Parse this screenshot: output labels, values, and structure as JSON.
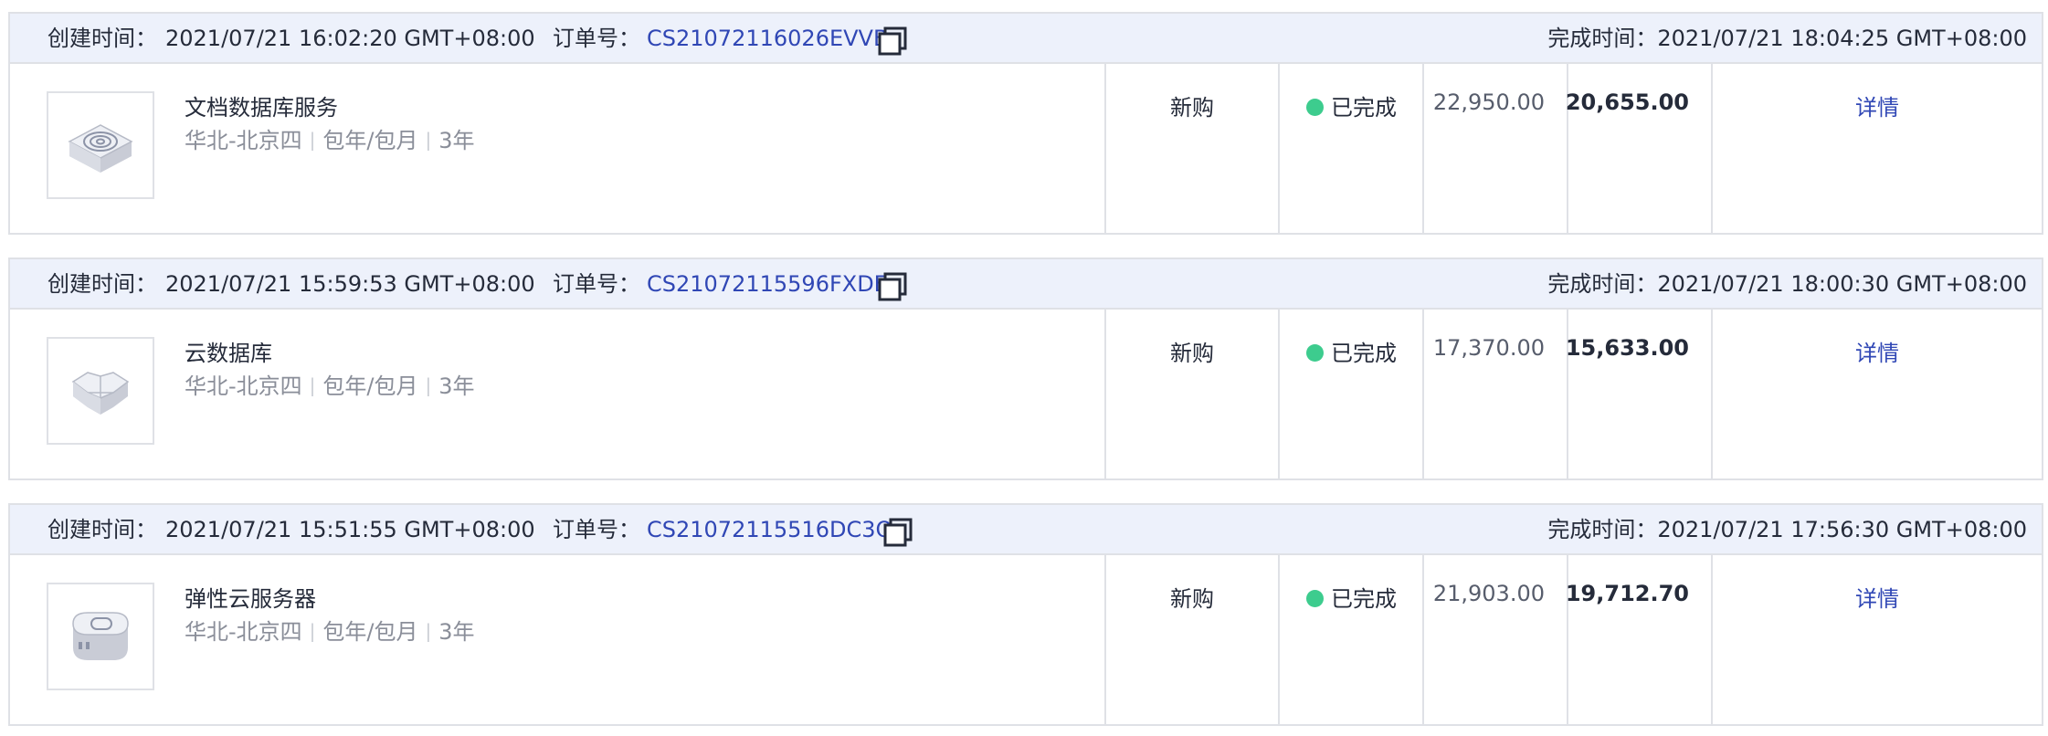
{
  "labels": {
    "created": "创建时间：",
    "order_no": "订单号：",
    "completed": "完成时间：",
    "separator": "|"
  },
  "colors": {
    "link": "#3047b5",
    "status_done": "#3dcc8e",
    "header_bg": "#edf1fb",
    "border": "#dfe1e6"
  },
  "orders": [
    {
      "created_time": "2021/07/21 16:02:20 GMT+08:00",
      "order_id": "CS21072116026EVVB",
      "completed_time": "2021/07/21 18:04:25 GMT+08:00",
      "product_icon": "document-database-icon",
      "product_name": "文档数据库服务",
      "region": "华北-北京四",
      "billing": "包年/包月",
      "duration": "3年",
      "order_type": "新购",
      "status": "已完成",
      "original_price": "22,950.00",
      "paid_price": "20,655.00",
      "detail_label": "详情"
    },
    {
      "created_time": "2021/07/21 15:59:53 GMT+08:00",
      "order_id": "CS21072115596FXDE",
      "completed_time": "2021/07/21 18:00:30 GMT+08:00",
      "product_icon": "cloud-database-icon",
      "product_name": "云数据库",
      "region": "华北-北京四",
      "billing": "包年/包月",
      "duration": "3年",
      "order_type": "新购",
      "status": "已完成",
      "original_price": "17,370.00",
      "paid_price": "15,633.00",
      "detail_label": "详情"
    },
    {
      "created_time": "2021/07/21 15:51:55 GMT+08:00",
      "order_id": "CS21072115516DC3Q",
      "completed_time": "2021/07/21 17:56:30 GMT+08:00",
      "product_icon": "elastic-cloud-server-icon",
      "product_name": "弹性云服务器",
      "region": "华北-北京四",
      "billing": "包年/包月",
      "duration": "3年",
      "order_type": "新购",
      "status": "已完成",
      "original_price": "21,903.00",
      "paid_price": "19,712.70",
      "detail_label": "详情"
    }
  ]
}
